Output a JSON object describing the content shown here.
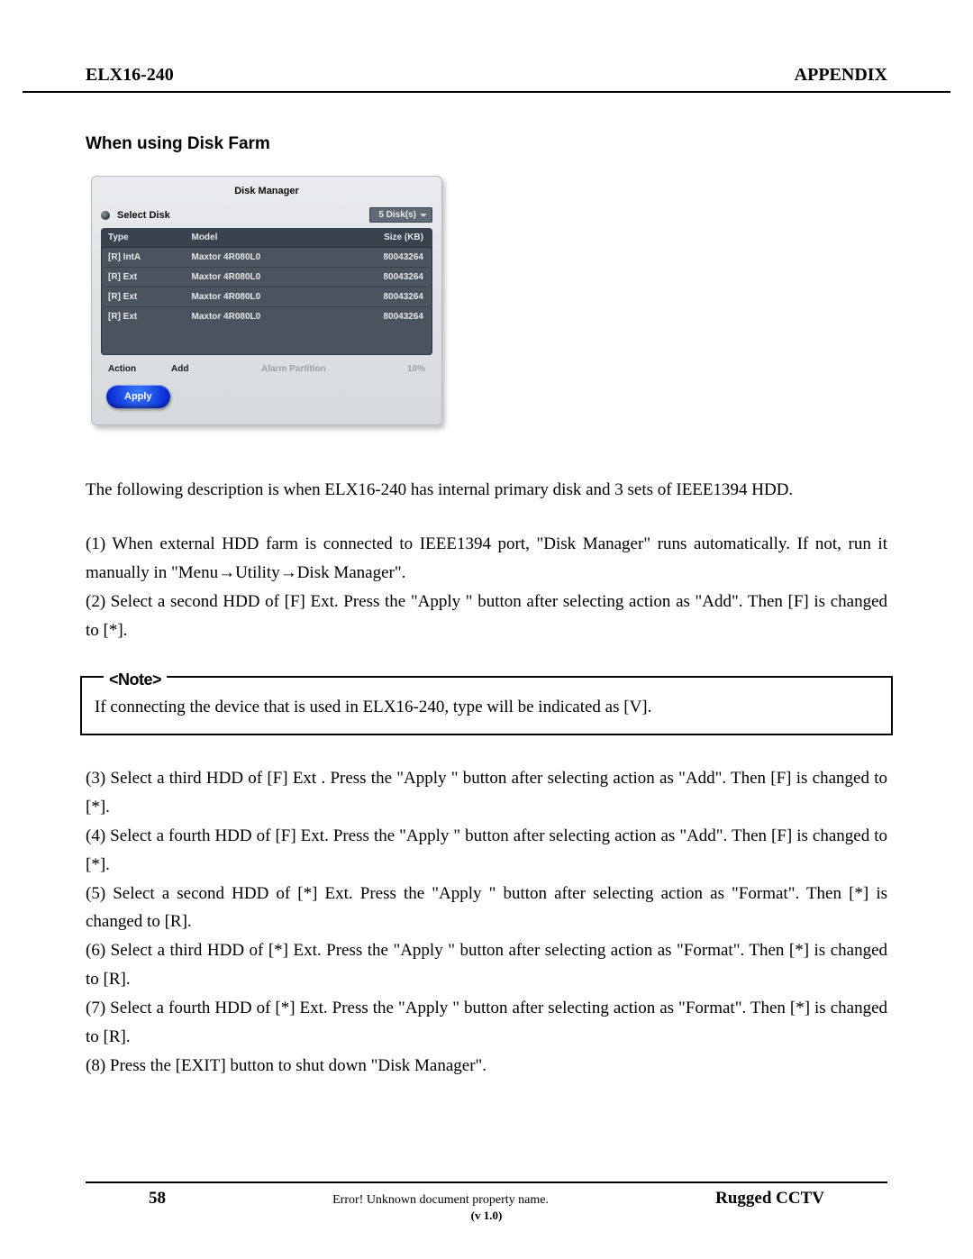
{
  "header": {
    "left": "ELX16-240",
    "right": "APPENDIX"
  },
  "section_title": "When using Disk Farm",
  "disk_manager": {
    "title": "Disk Manager",
    "select_disk_label": "Select Disk",
    "disk_count": "5 Disk(s)",
    "columns": {
      "type": "Type",
      "model": "Model",
      "size": "Size (KB)"
    },
    "rows": [
      {
        "type": "[R] IntA",
        "model": "Maxtor 4R080L0",
        "size": "80043264"
      },
      {
        "type": "[R] Ext",
        "model": "Maxtor 4R080L0",
        "size": "80043264"
      },
      {
        "type": "[R] Ext",
        "model": "Maxtor 4R080L0",
        "size": "80043264"
      },
      {
        "type": "[R] Ext",
        "model": "Maxtor 4R080L0",
        "size": "80043264"
      }
    ],
    "action_label": "Action",
    "action_value": "Add",
    "alarm_partition_label": "Alarm Partition",
    "alarm_partition_value": "10%",
    "apply": "Apply"
  },
  "intro": "The following description is when ELX16-240 has internal primary disk and 3 sets of IEEE1394 HDD.",
  "p1a": "(1) When external HDD farm is connected to IEEE1394 port, \"Disk Manager\" runs automatically. If not, run it manually in \"Menu",
  "p1b": "Utility",
  "p1c": "Disk Manager\".",
  "p2": "(2) Select a second HDD of [F] Ext. Press the \"Apply \" button after selecting action as \"Add\". Then [F] is changed to [*].",
  "note": {
    "legend": "<Note>",
    "text": "If connecting the device that is used in ELX16-240, type will be indicated as [V]."
  },
  "p3": "(3) Select a third HDD of [F] Ext . Press the \"Apply \" button after selecting action as \"Add\". Then [F] is changed to [*].",
  "p4": "(4) Select a fourth HDD of [F] Ext. Press the \"Apply \" button after selecting action as \"Add\". Then [F] is changed to [*].",
  "p5": "(5) Select a second HDD of [*] Ext. Press the \"Apply \" button after selecting action as \"Format\". Then [*] is changed to [R].",
  "p6": "(6) Select a third HDD of [*] Ext. Press the \"Apply \" button after selecting action as \"Format\". Then [*] is changed to [R].",
  "p7": "(7) Select a fourth HDD of [*] Ext. Press the \"Apply \" button after selecting action as \"Format\". Then [*] is changed to [R].",
  "p8": "(8) Press the [EXIT] button to shut down \"Disk Manager\".",
  "footer": {
    "pageno": "58",
    "center": "Error! Unknown document property name.",
    "version": "(v 1.0)",
    "right": "Rugged CCTV"
  },
  "arrow": "→"
}
